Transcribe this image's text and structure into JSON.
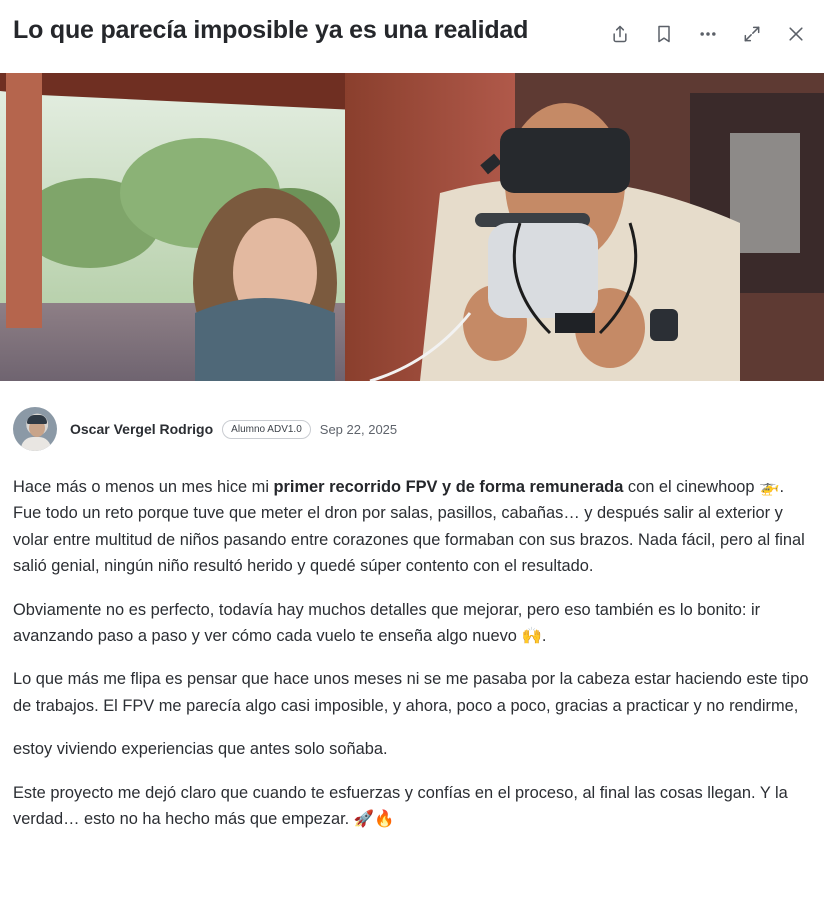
{
  "post": {
    "title": "Lo que parecía imposible ya es una realidad"
  },
  "header_actions": {
    "share": "share-icon",
    "bookmark": "bookmark-icon",
    "more": "more-horizontal-icon",
    "expand": "expand-icon",
    "close": "close-icon"
  },
  "author": {
    "name": "Oscar Vergel Rodrigo",
    "badge": "Alumno ADV1.0",
    "date": "Sep 22, 2025"
  },
  "body": {
    "p1_a": "Hace más o menos un mes hice mi ",
    "p1_bold": "primer recorrido FPV y de forma remunerada",
    "p1_b": " con el cinewhoop ",
    "p1_emoji": "🚁",
    "p1_c": ". Fue todo un reto porque tuve que meter el dron por salas, pasillos, cabañas… y después salir al exterior y volar entre multitud de niños pasando entre corazones que formaban con sus brazos. Nada fácil, pero al final salió genial, ningún niño resultó herido y quedé súper contento con el resultado.",
    "p2_a": "Obviamente no es perfecto, todavía hay muchos detalles que mejorar, pero eso también es lo bonito: ir avanzando paso a paso y ver cómo cada vuelo te enseña algo nuevo ",
    "p2_emoji": "🙌",
    "p2_b": ".",
    "p3": "Lo que más me flipa es pensar que hace unos meses ni se me pasaba por la cabeza estar haciendo este tipo de trabajos. El FPV me parecía algo casi imposible, y ahora, poco a poco, gracias a practicar y no rendirme,",
    "p4": "estoy viviendo experiencias que antes solo soñaba.",
    "p5_a": "Este proyecto me dejó claro que cuando te esfuerzas y confías en el proceso, al final las cosas llegan. Y la verdad… esto no ha hecho más que empezar. ",
    "p5_emoji": "🚀🔥"
  },
  "colors": {
    "title": "#25272b",
    "text": "#2b2e33",
    "icon": "#5b6068",
    "muted": "#5f646c"
  }
}
